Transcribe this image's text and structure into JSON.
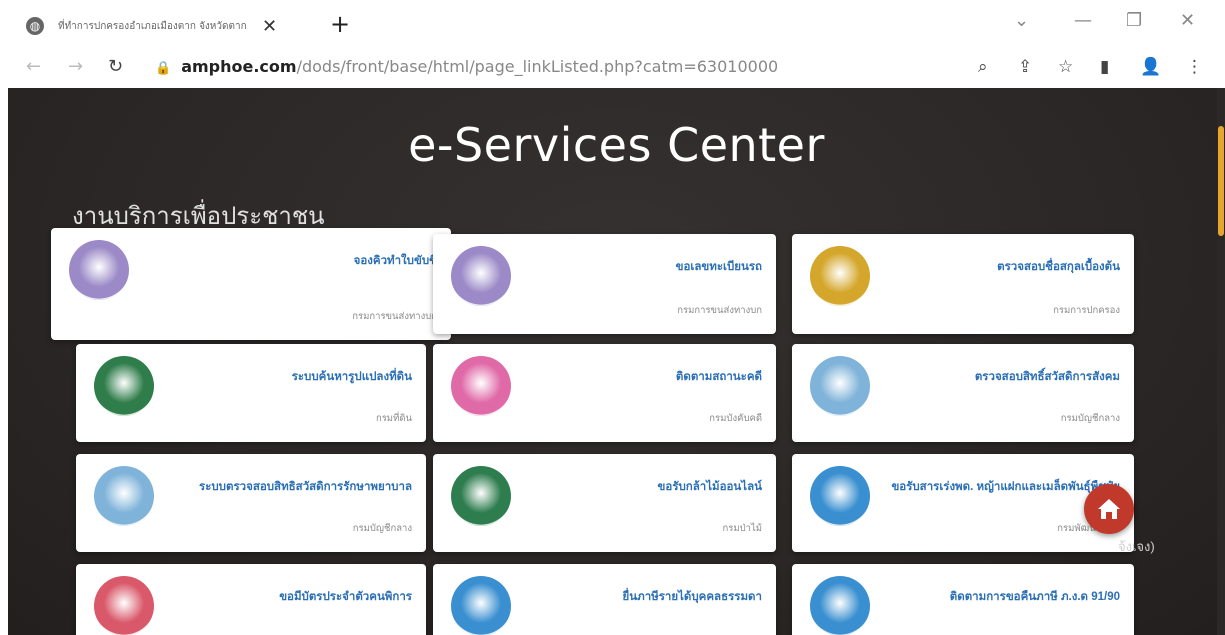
{
  "browser": {
    "tab_title": "ที่ทำการปกครองอำเภอเมืองตาก จังหวัดตาก",
    "tab_close": "✕",
    "new_tab": "+",
    "url_host": "amphoe.com",
    "url_path": "/dods/front/base/html/page_linkListed.php?catm=63010000"
  },
  "page": {
    "hero_title": "e-Services Center",
    "section_title": "งานบริการเพื่อประชาชน",
    "side_hint": "จ้งเจง)"
  },
  "cards": [
    {
      "title": "จองคิวทำใบขับขี่",
      "org": "กรมการขนส่งทางบก",
      "logo": "land-transport-seal-icon",
      "color": "#9b8ac7"
    },
    {
      "title": "ขอเลขทะเบียนรถ",
      "org": "กรมการขนส่งทางบก",
      "logo": "land-transport-seal-icon",
      "color": "#9b8ac7"
    },
    {
      "title": "ตรวจสอบชื่อสกุลเบื้องต้น",
      "org": "กรมการปกครอง",
      "logo": "provincial-admin-seal-icon",
      "color": "#d4a72c"
    },
    {
      "title": "ระบบค้นหารูปแปลงที่ดิน",
      "org": "กรมที่ดิน",
      "logo": "land-department-seal-icon",
      "color": "#2f7d4a"
    },
    {
      "title": "ติดตามสถานะคดี",
      "org": "กรมบังคับคดี",
      "logo": "legal-execution-seal-icon",
      "color": "#e06aa8"
    },
    {
      "title": "ตรวจสอบสิทธิ์สวัสดิการสังคม",
      "org": "กรมบัญชีกลาง",
      "logo": "comptroller-general-seal-icon",
      "color": "#7fb3d9"
    },
    {
      "title": "ระบบตรวจสอบสิทธิสวัสดิการรักษาพยาบาล",
      "org": "กรมบัญชีกลาง",
      "logo": "comptroller-general-seal-icon",
      "color": "#7fb3d9"
    },
    {
      "title": "ขอรับกล้าไม้ออนไลน์",
      "org": "กรมป่าไม้",
      "logo": "forestry-seal-icon",
      "color": "#2e7d4f"
    },
    {
      "title": "ขอรับสารเร่งพด. หญ้าแฝกและเมล็ดพันธุ์พืชปุ๋ย",
      "org": "กรมพัฒนาที่ดิน",
      "logo": "land-development-seal-icon",
      "color": "#3a8fd0"
    },
    {
      "title": "ขอมีบัตรประจำตัวคนพิการ",
      "org": "",
      "logo": "disability-empowerment-seal-icon",
      "color": "#d9596a"
    },
    {
      "title": "ยื่นภาษีรายได้บุคคลธรรมดา",
      "org": "",
      "logo": "revenue-seal-icon",
      "color": "#3a8fd0"
    },
    {
      "title": "ติดตามการขอคืนภาษี ภ.ง.ด 91/90",
      "org": "",
      "logo": "revenue-seal-icon",
      "color": "#3a8fd0"
    }
  ],
  "colors": {
    "accent": "#2b6fb5",
    "home_button": "#c0392b",
    "scroll_thumb": "#e8a530"
  }
}
